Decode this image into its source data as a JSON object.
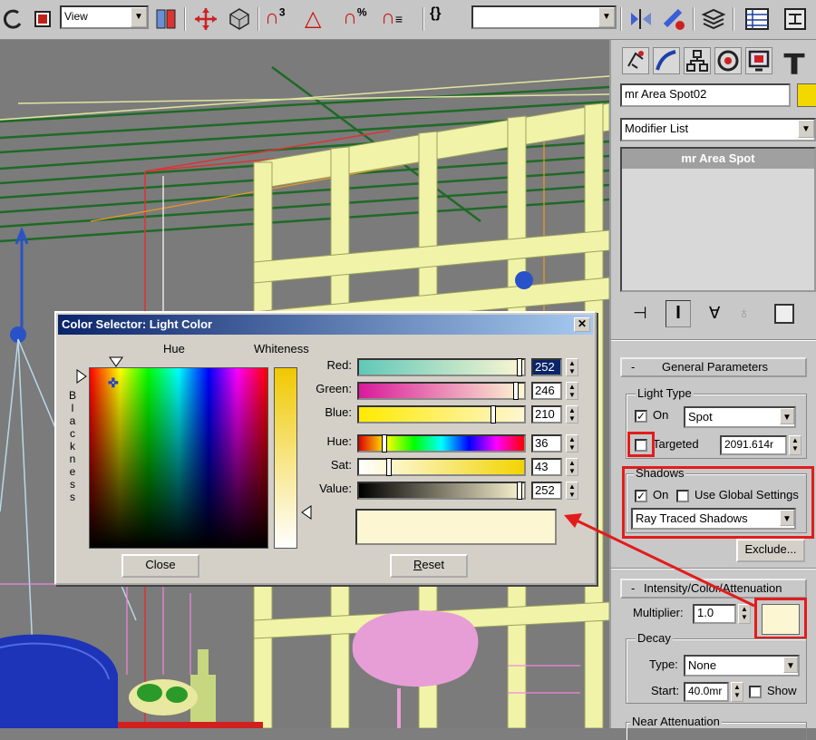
{
  "toolbar": {
    "view_combo": "View",
    "named_selection_combo": "",
    "icons": [
      "undo-icon",
      "select-object-icon",
      "view-combo",
      "layer-icon",
      "select-move-icon",
      "unlink-icon",
      "snap-3d-icon",
      "angle-snap-icon",
      "percent-snap-icon",
      "spinner-snap-icon",
      "edit-named-selection-icon",
      "named-selection-combo",
      "mirror-icon",
      "align-icon",
      "layer-manager-icon",
      "curve-editor-icon",
      "schematic-view-icon"
    ]
  },
  "command_panel": {
    "tabs": [
      "create-tab",
      "modify-tab",
      "hierarchy-tab",
      "motion-tab",
      "display-tab",
      "utilities-tab"
    ],
    "object_name": "mr Area Spot02",
    "object_color": "#f2d700",
    "modifier_list": "Modifier List",
    "stack_item": "mr Area Spot",
    "general_parameters": {
      "title": "General Parameters",
      "collapse": "-",
      "light_type_group": "Light Type",
      "on_label": "On",
      "on_checked": true,
      "light_type": "Spot",
      "targeted_label": "Targeted",
      "targeted_checked": false,
      "target_distance": "2091.614r",
      "shadows_group": "Shadows",
      "shadows_on_label": "On",
      "shadows_on_checked": true,
      "use_global_label": "Use Global Settings",
      "use_global_checked": false,
      "shadow_type": "Ray Traced Shadows",
      "exclude_button": "Exclude..."
    },
    "intensity": {
      "title": "Intensity/Color/Attenuation",
      "collapse": "-",
      "multiplier_label": "Multiplier:",
      "multiplier_value": "1.0",
      "light_color": "#fcf6d2",
      "decay_group": "Decay",
      "type_label": "Type:",
      "type_value": "None",
      "start_label": "Start:",
      "start_value": "40.0mr",
      "show_label": "Show",
      "near_attenuation_group": "Near Attenuation"
    }
  },
  "dialog": {
    "title": "Color Selector: Light Color",
    "hue_label": "Hue",
    "whiteness_label": "Whiteness",
    "blackness_label": "Blackness",
    "close_button": "Close",
    "reset_button": "Reset",
    "reset_mnemonic": "R",
    "reset_rest": "eset",
    "swatch_color": "#fcf6d2",
    "sliders": [
      {
        "label": "Red:",
        "value": "252",
        "fraction": 0.988
      },
      {
        "label": "Green:",
        "value": "246",
        "fraction": 0.965
      },
      {
        "label": "Blue:",
        "value": "210",
        "fraction": 0.824
      },
      {
        "label": "Hue:",
        "value": "36",
        "fraction": 0.141
      },
      {
        "label": "Sat:",
        "value": "43",
        "fraction": 0.169
      },
      {
        "label": "Value:",
        "value": "252",
        "fraction": 0.988
      }
    ]
  }
}
